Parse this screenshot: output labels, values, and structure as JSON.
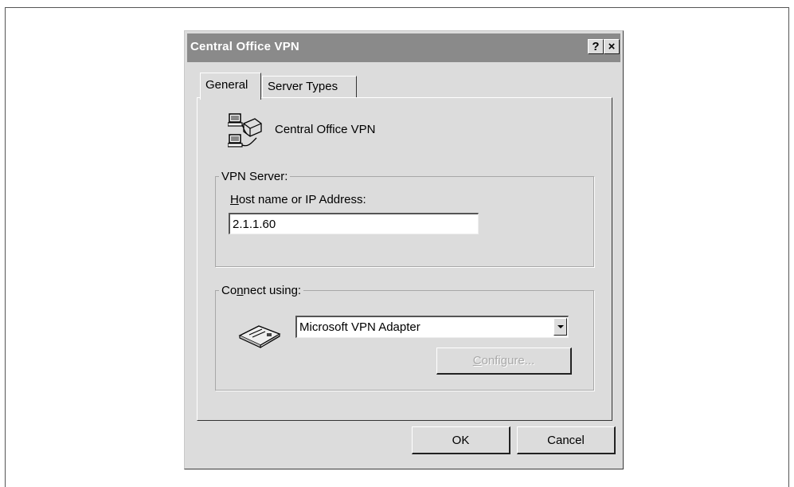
{
  "dialog": {
    "title": "Central Office VPN",
    "help_label": "?",
    "close_label": "×"
  },
  "tabs": [
    {
      "label": "General",
      "active": true
    },
    {
      "label": "Server Types",
      "active": false
    }
  ],
  "general": {
    "connection_name": "Central Office VPN",
    "connection_icon": "dial-up-networking-icon",
    "vpn_server": {
      "group_label": "VPN Server:",
      "host_label_mnemonic": "H",
      "host_label_rest": "ost name or IP Address:",
      "host_value": "2.1.1.60"
    },
    "connect_using": {
      "label_before": "Co",
      "label_mnemonic": "n",
      "label_after": "nect using:",
      "adapter_icon": "network-adapter-icon",
      "selected_adapter": "Microsoft VPN Adapter",
      "configure_label_mnemonic": "C",
      "configure_label_rest": "onfigure...",
      "configure_enabled": false
    }
  },
  "footer": {
    "ok_label": "OK",
    "cancel_label": "Cancel"
  }
}
